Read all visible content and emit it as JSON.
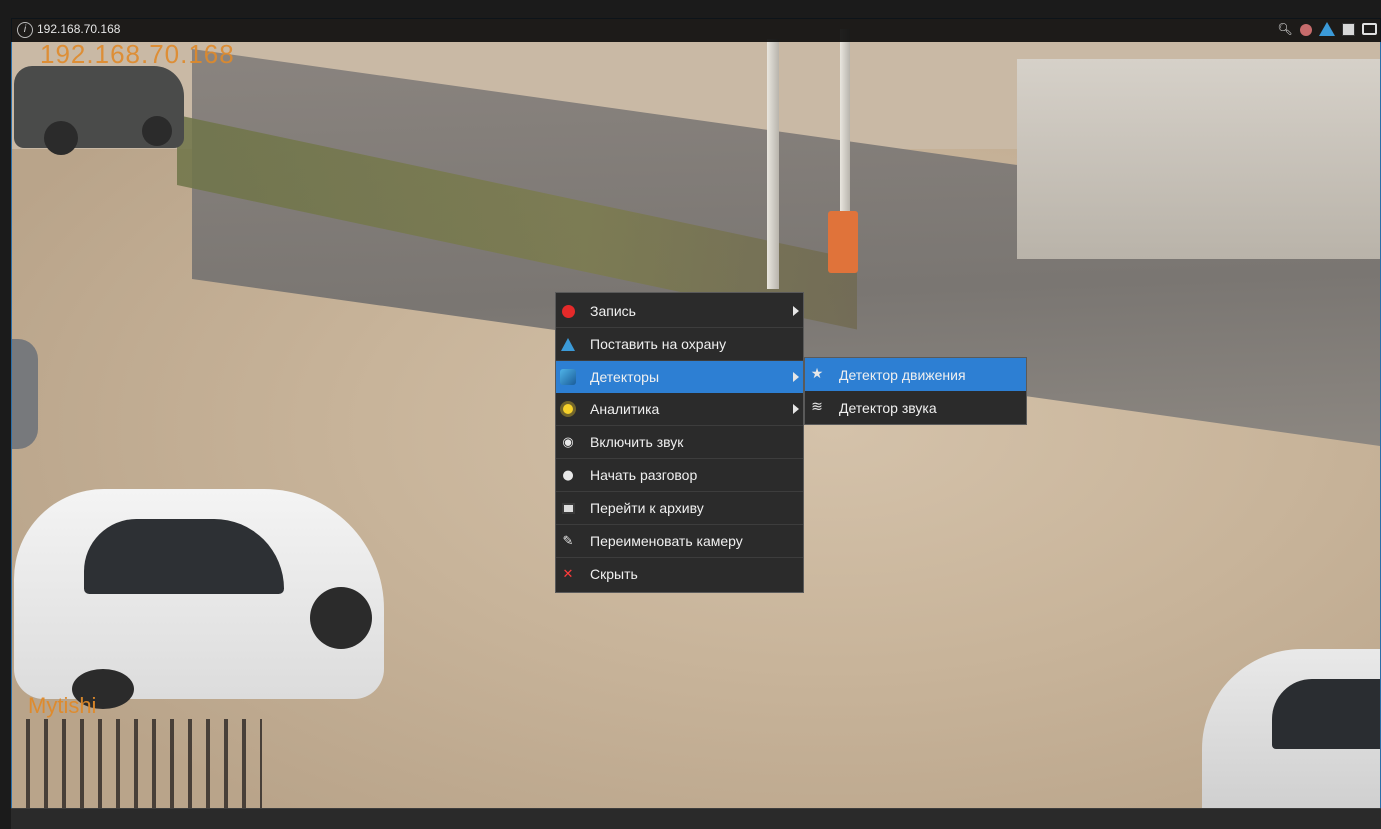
{
  "camera": {
    "title": "192.168.70.168",
    "osd_ip": "192.168.70.168",
    "osd_name": "Mytishi"
  },
  "toolbar": {
    "icons": [
      "zoom-icon",
      "record-icon",
      "arm-icon",
      "archive-icon",
      "snapshot-icon"
    ]
  },
  "context_menu": {
    "items": [
      {
        "label": "Запись",
        "icon": "record-icon",
        "has_submenu": true
      },
      {
        "label": "Поставить на охрану",
        "icon": "arm-icon",
        "has_submenu": false
      },
      {
        "label": "Детекторы",
        "icon": "detectors-icon",
        "has_submenu": true,
        "active": true
      },
      {
        "label": "Аналитика",
        "icon": "analytics-icon",
        "has_submenu": true
      },
      {
        "label": "Включить звук",
        "icon": "speaker-icon",
        "has_submenu": false
      },
      {
        "label": "Начать разговор",
        "icon": "microphone-icon",
        "has_submenu": false
      },
      {
        "label": "Перейти к архиву",
        "icon": "archive-icon",
        "has_submenu": false
      },
      {
        "label": "Переименовать камеру",
        "icon": "pencil-icon",
        "has_submenu": false
      },
      {
        "label": "Скрыть",
        "icon": "hide-icon",
        "has_submenu": false
      }
    ]
  },
  "submenu": {
    "items": [
      {
        "label": "Детектор движения",
        "icon": "running-man-icon",
        "active": true
      },
      {
        "label": "Детектор звука",
        "icon": "sound-wave-icon",
        "active": false
      }
    ]
  },
  "colors": {
    "accent": "#2d7fd3",
    "osd_text": "#e08a2a",
    "menu_bg": "#2b2b2b"
  }
}
